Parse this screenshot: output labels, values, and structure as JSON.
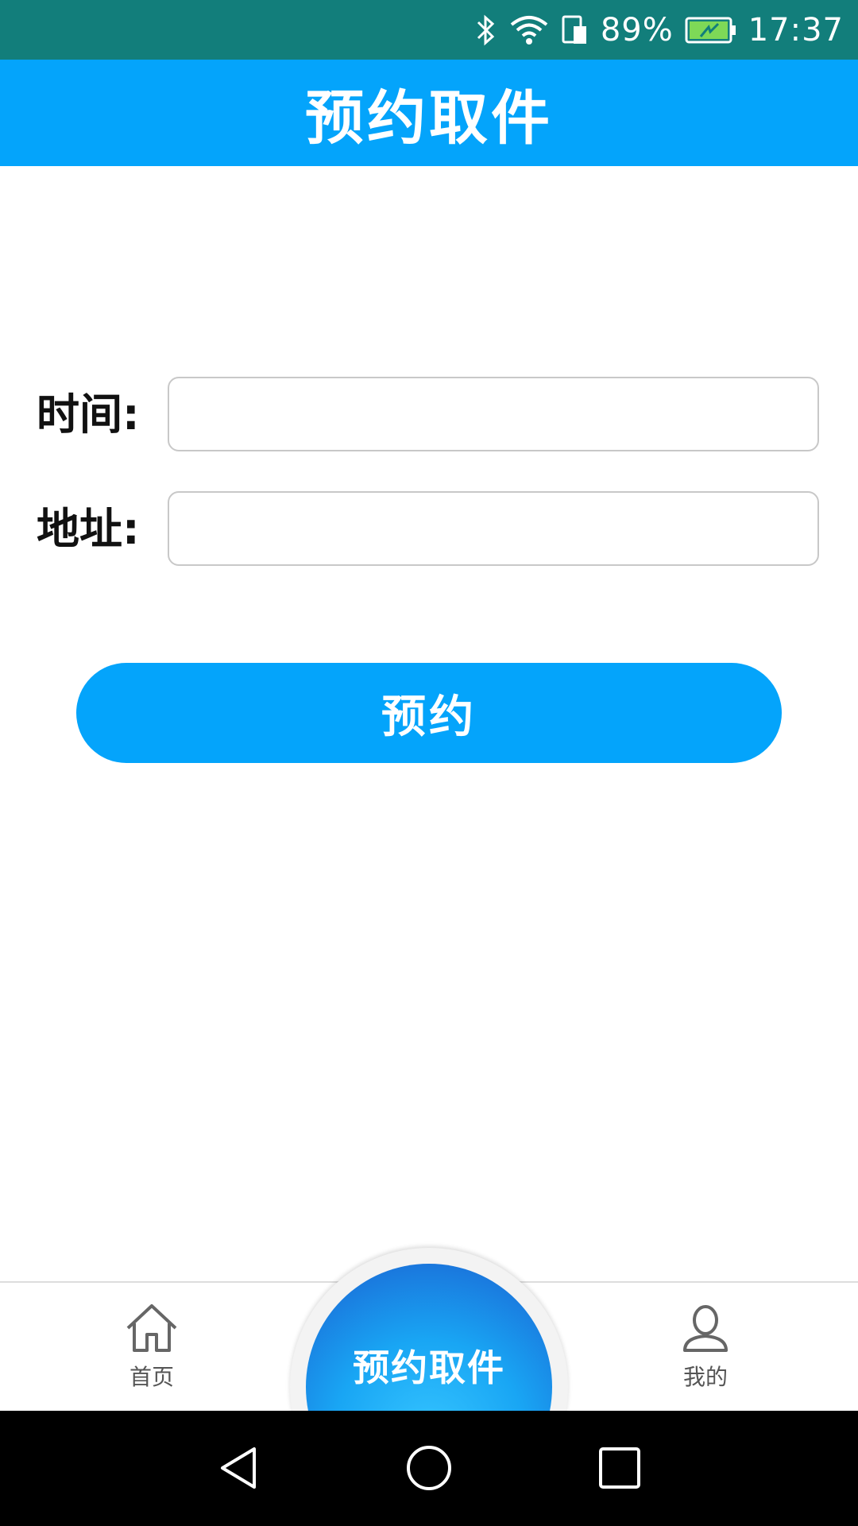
{
  "status_bar": {
    "battery_percent": "89%",
    "time": "17:37",
    "icons": [
      "bluetooth-icon",
      "wifi-icon",
      "sim-card-icon",
      "battery-charging-icon"
    ],
    "background": "#127e7b"
  },
  "header": {
    "title": "预约取件",
    "background": "#04a4fb"
  },
  "form": {
    "time_label": "时间:",
    "time_value": "",
    "address_label": "地址:",
    "address_value": "",
    "submit_label": "预约"
  },
  "tab_bar": {
    "home_label": "首页",
    "home_icon": "home-icon",
    "center_label": "预约取件",
    "mine_label": "我的",
    "mine_icon": "user-icon"
  },
  "nav_bar": {
    "icons": [
      "back-icon",
      "home-circle-icon",
      "recent-apps-icon"
    ]
  },
  "colors": {
    "accent": "#04a4fb",
    "status_bar": "#127e7b"
  }
}
